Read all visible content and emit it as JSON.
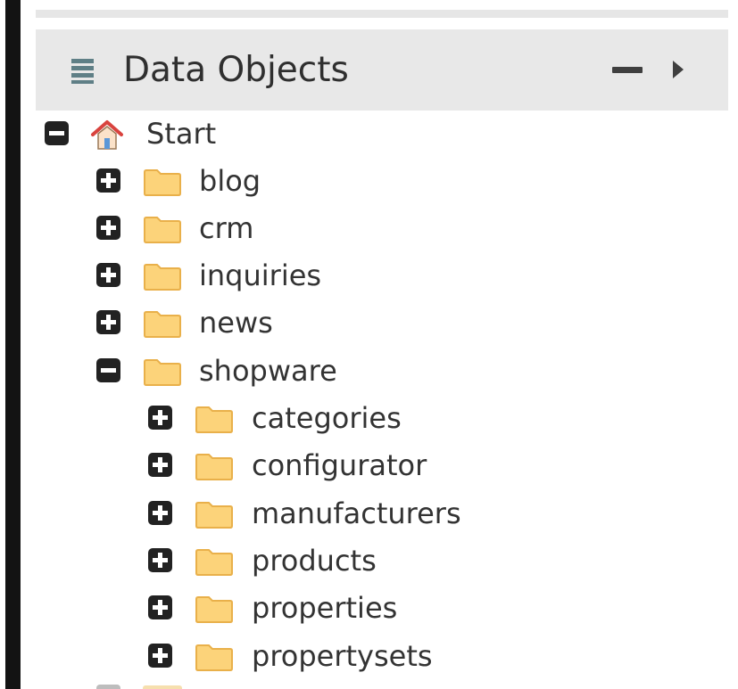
{
  "panel": {
    "title": "Data Objects",
    "icon": "database-icon",
    "collapse_icon": "minus-icon",
    "expand_icon": "caret-right-icon"
  },
  "colors": {
    "header_bg": "#e8e8e8",
    "folder_fill": "#fcd37a",
    "folder_edge": "#e9b04a",
    "toggle_bg": "#222222",
    "home_roof": "#d9433e"
  },
  "tree": {
    "root": {
      "label": "Start",
      "icon": "home-icon",
      "expanded": true,
      "children": [
        {
          "label": "blog",
          "icon": "folder-icon",
          "expanded": false
        },
        {
          "label": "crm",
          "icon": "folder-icon",
          "expanded": false
        },
        {
          "label": "inquiries",
          "icon": "folder-icon",
          "expanded": false
        },
        {
          "label": "news",
          "icon": "folder-icon",
          "expanded": false
        },
        {
          "label": "shopware",
          "icon": "folder-icon",
          "expanded": true,
          "children": [
            {
              "label": "categories",
              "icon": "folder-icon",
              "expanded": false
            },
            {
              "label": "configurator",
              "icon": "folder-icon",
              "expanded": false
            },
            {
              "label": "manufacturers",
              "icon": "folder-icon",
              "expanded": false
            },
            {
              "label": "products",
              "icon": "folder-icon",
              "expanded": false
            },
            {
              "label": "properties",
              "icon": "folder-icon",
              "expanded": false
            },
            {
              "label": "propertysets",
              "icon": "folder-icon",
              "expanded": false
            }
          ]
        }
      ]
    }
  }
}
